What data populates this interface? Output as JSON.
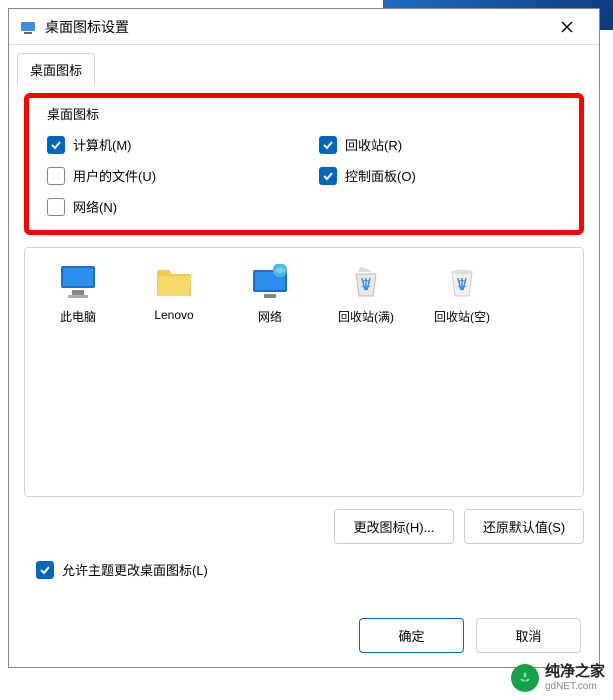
{
  "titlebar": {
    "title": "桌面图标设置"
  },
  "tabs": {
    "main": "桌面图标"
  },
  "group": {
    "label": "桌面图标"
  },
  "checkboxes": {
    "computer": {
      "label": "计算机(M)",
      "checked": true
    },
    "recyclebin": {
      "label": "回收站(R)",
      "checked": true
    },
    "userfiles": {
      "label": "用户的文件(U)",
      "checked": false
    },
    "controlpanel": {
      "label": "控制面板(O)",
      "checked": true
    },
    "network": {
      "label": "网络(N)",
      "checked": false
    }
  },
  "icons": {
    "thispc": "此电脑",
    "lenovo": "Lenovo",
    "network": "网络",
    "recyclebin_full": "回收站(满)",
    "recyclebin_empty": "回收站(空)"
  },
  "buttons": {
    "change_icon": "更改图标(H)...",
    "restore_default": "还原默认值(S)",
    "ok": "确定",
    "cancel": "取消"
  },
  "theme_checkbox": {
    "label": "允许主题更改桌面图标(L)",
    "checked": true
  },
  "watermark": {
    "cn": "纯净之家",
    "en": "gdNET.com"
  }
}
